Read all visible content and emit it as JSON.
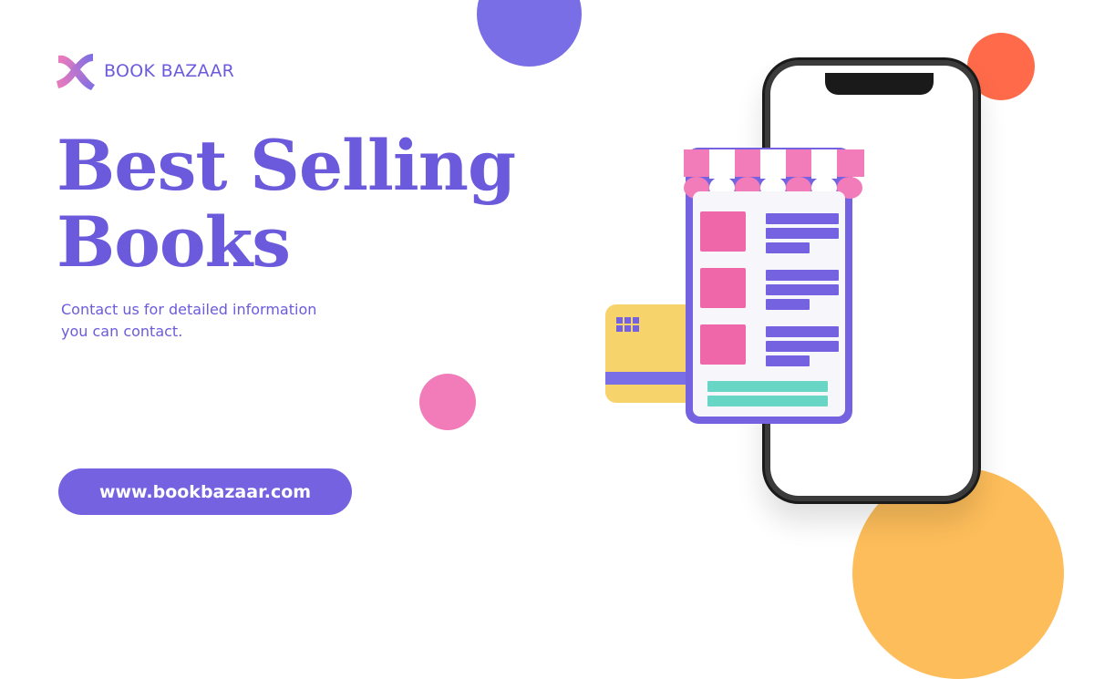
{
  "brand": {
    "name": "BOOK BAZAAR",
    "logo_icon": "x-ribbon-logo-icon"
  },
  "headline": {
    "line1": "Best Selling",
    "line2": "Books"
  },
  "subtitle": {
    "line1": "Contact us for detailed information",
    "line2": "you can contact."
  },
  "cta": {
    "url_label": "www.bookbazaar.com"
  },
  "colors": {
    "primary": "#7462e0",
    "text_purple": "#6b5bdc",
    "pink": "#f27bb9",
    "orange": "#ff6b4a",
    "yellow": "#fdbd5a",
    "teal": "#67d6c5"
  },
  "illustration": {
    "phone_icon": "smartphone-icon",
    "store_icon": "storefront-icon",
    "card_icon": "credit-card-icon"
  }
}
